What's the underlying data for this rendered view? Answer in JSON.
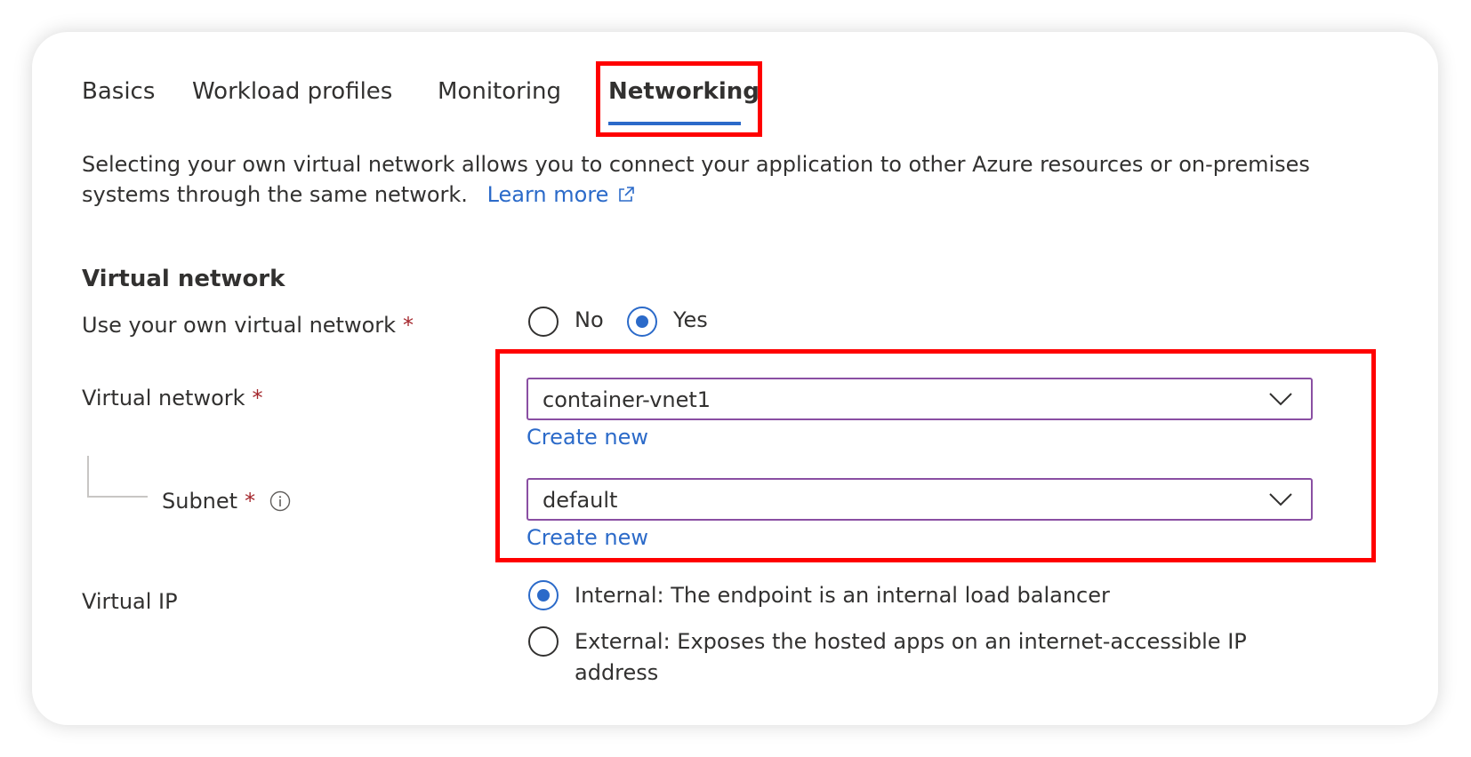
{
  "tabs": [
    {
      "label": "Basics",
      "active": false
    },
    {
      "label": "Workload profiles",
      "active": false
    },
    {
      "label": "Monitoring",
      "active": false
    },
    {
      "label": "Networking",
      "active": true
    }
  ],
  "description": {
    "line1": "Selecting your own virtual network allows you to connect your application to other Azure resources or on-premises",
    "line2": "systems through the same network.",
    "learn_more": "Learn more"
  },
  "section_title": "Virtual network",
  "use_own_vnet": {
    "label": "Use your own virtual network",
    "required_mark": "*",
    "options": [
      {
        "label": "No",
        "selected": false
      },
      {
        "label": "Yes",
        "selected": true
      }
    ]
  },
  "virtual_network": {
    "label": "Virtual network",
    "required_mark": "*",
    "value": "container-vnet1",
    "create_new": "Create new"
  },
  "subnet": {
    "label": "Subnet",
    "required_mark": "*",
    "value": "default",
    "create_new": "Create new"
  },
  "virtual_ip": {
    "label": "Virtual IP",
    "options": [
      {
        "label": "Internal: The endpoint is an internal load balancer",
        "selected": true
      },
      {
        "label_line1": "External: Exposes the hosted apps on an internet-accessible IP",
        "label_line2": "address",
        "selected": false
      }
    ]
  },
  "colors": {
    "accent": "#2b6ac9",
    "highlight": "#ff0000",
    "required": "#a4262c",
    "select_border": "#8a4fa3"
  }
}
